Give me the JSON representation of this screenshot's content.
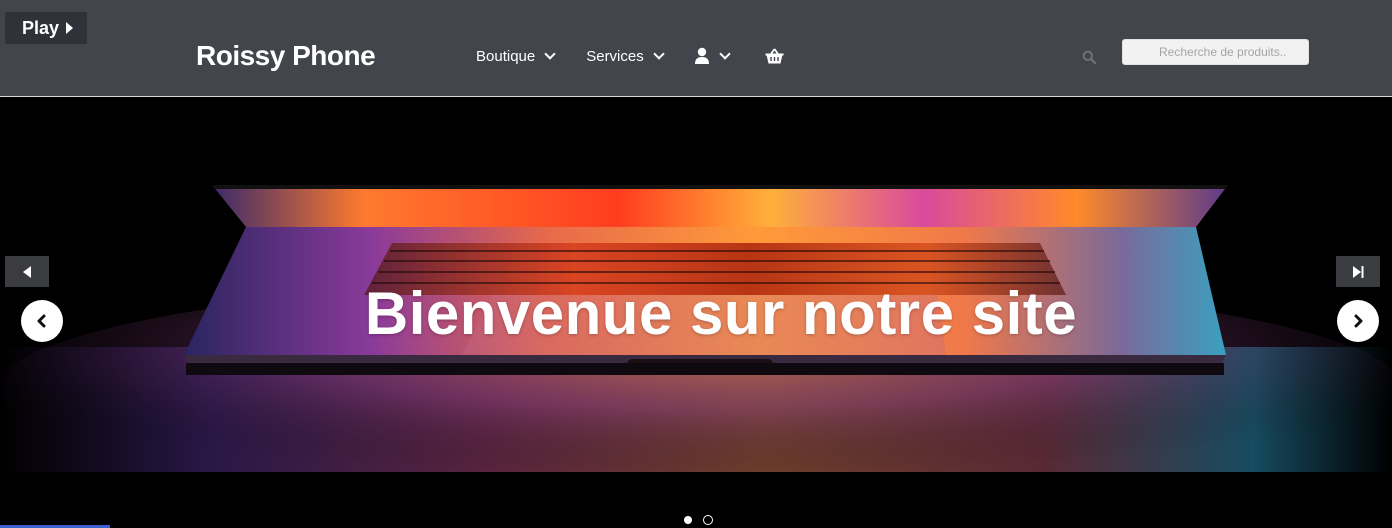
{
  "play_button": {
    "label": "Play"
  },
  "header": {
    "brand": "Roissy Phone",
    "nav": [
      {
        "label": "Boutique",
        "icon": "chevron-down-icon"
      },
      {
        "label": "Services",
        "icon": "chevron-down-icon"
      }
    ],
    "account_icon": "user-icon",
    "cart_icon": "basket-icon",
    "search": {
      "icon": "search-icon",
      "placeholder": "Recherche de produits..",
      "value": ""
    }
  },
  "hero": {
    "title": "Bienvenue sur notre site",
    "slide_count": 2,
    "active_slide": 1
  },
  "colors": {
    "header_bg": "#42454c",
    "play_bg": "#2f3238",
    "accent_blue": "#3a5fd0"
  }
}
